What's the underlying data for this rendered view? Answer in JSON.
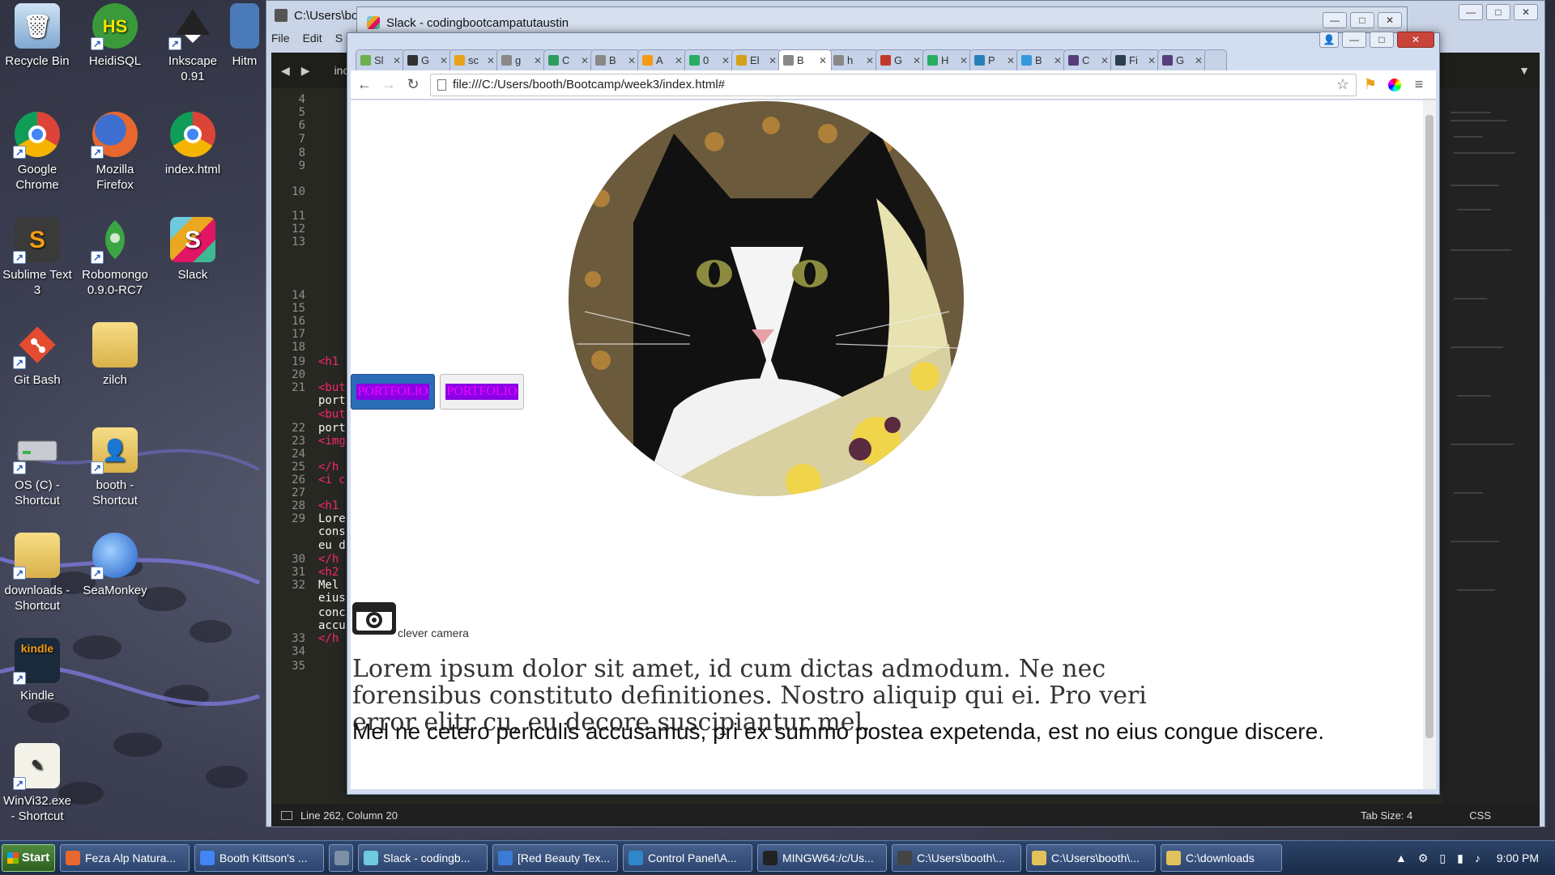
{
  "desktop": {
    "icons": [
      {
        "label": "Recycle Bin"
      },
      {
        "label": "HeidiSQL"
      },
      {
        "label": "Inkscape 0.91"
      },
      {
        "label": "Hitm"
      },
      {
        "label": "Google Chrome"
      },
      {
        "label": "Mozilla Firefox"
      },
      {
        "label": "index.html"
      },
      {
        "label": "Sublime Text 3"
      },
      {
        "label": "Robomongo 0.9.0-RC7"
      },
      {
        "label": "Slack"
      },
      {
        "label": "Git Bash"
      },
      {
        "label": "zilch"
      },
      {
        "label": "OS (C) - Shortcut"
      },
      {
        "label": "booth - Shortcut"
      },
      {
        "label": "downloads - Shortcut"
      },
      {
        "label": "SeaMonkey"
      },
      {
        "label": "Kindle"
      },
      {
        "label": "WinVi32.exe - Shortcut"
      }
    ]
  },
  "editor": {
    "title": "C:\\Users\\boo",
    "menu": [
      "File",
      "Edit",
      "S"
    ],
    "tab_label": "inc",
    "line_numbers": [
      "4",
      "5",
      "6",
      "7",
      "8",
      "9",
      "10",
      "11",
      "12",
      "13",
      "14",
      "15",
      "16",
      "17",
      "18",
      "19",
      "20",
      "21",
      "22",
      "23",
      "24",
      "25",
      "26",
      "27",
      "28",
      "29",
      "30",
      "31",
      "32",
      "33",
      "34",
      "35"
    ],
    "code_fragments": [
      "<h1",
      "<but",
      "port",
      "<but",
      "port",
      "<img",
      "</h",
      "<i c",
      "<h1",
      "Lore",
      "cons",
      "eu d",
      "</h",
      "<h2",
      "Mel",
      "eius",
      "conc",
      "accu",
      "</h"
    ],
    "status": {
      "position": "Line 262, Column 20",
      "tab_size": "Tab Size: 4",
      "syntax": "CSS"
    }
  },
  "slack_window": {
    "title": "Slack - codingbootcampatutaustin"
  },
  "chrome": {
    "tabs": [
      {
        "label": "Sl",
        "color": "#6ab04c"
      },
      {
        "label": "G",
        "color": "#333333"
      },
      {
        "label": "sc",
        "color": "#e8a317"
      },
      {
        "label": "g",
        "color": "#888888"
      },
      {
        "label": "C",
        "color": "#2e9c5e"
      },
      {
        "label": "B",
        "color": "#888888"
      },
      {
        "label": "A",
        "color": "#f39c12"
      },
      {
        "label": "0",
        "color": "#27ae60"
      },
      {
        "label": "El",
        "color": "#d4a017"
      },
      {
        "label": "B",
        "color": "#888888"
      },
      {
        "label": "h",
        "color": "#888888"
      },
      {
        "label": "G",
        "color": "#c0392b"
      },
      {
        "label": "H",
        "color": "#27ae60"
      },
      {
        "label": "P",
        "color": "#2980b9"
      },
      {
        "label": "B",
        "color": "#3498db"
      },
      {
        "label": "C",
        "color": "#563d7c"
      },
      {
        "label": "Fi",
        "color": "#2c3e50"
      },
      {
        "label": "G",
        "color": "#563d7c"
      }
    ],
    "url": "file:///C:/Users/booth/Bootcamp/week3/index.html#"
  },
  "page": {
    "button1": "PORTFOLIO",
    "button2": "PORTFOLIO",
    "camera_caption": "clever camera",
    "heading1": "Lorem ipsum dolor sit amet, id cum dictas admodum. Ne nec forensibus constituto definitiones. Nostro aliquip qui ei. Pro veri error elitr cu, eu decore suscipiantur mel.",
    "heading2": "Mel ne cetero periculis accusamus, pri ex summo postea expetenda, est no eius congue discere."
  },
  "taskbar": {
    "start": "Start",
    "items": [
      {
        "label": "Feza Alp Natura...",
        "color": "#e8672e"
      },
      {
        "label": "Booth Kittson's ...",
        "color": "#4285f4"
      },
      {
        "label": "",
        "color": "#7f8fa6"
      },
      {
        "label": "Slack - codingb...",
        "color": "#6ecadc"
      },
      {
        "label": "[Red Beauty Tex...",
        "color": "#3a7bd5"
      },
      {
        "label": "Control Panel\\A...",
        "color": "#2f86c8"
      },
      {
        "label": "MINGW64:/c/Us...",
        "color": "#222222"
      },
      {
        "label": "C:\\Users\\booth\\...",
        "color": "#444444"
      },
      {
        "label": "C:\\Users\\booth\\...",
        "color": "#e3c15a"
      },
      {
        "label": "C:\\downloads",
        "color": "#e3c15a"
      }
    ],
    "clock": "9:00 PM"
  }
}
